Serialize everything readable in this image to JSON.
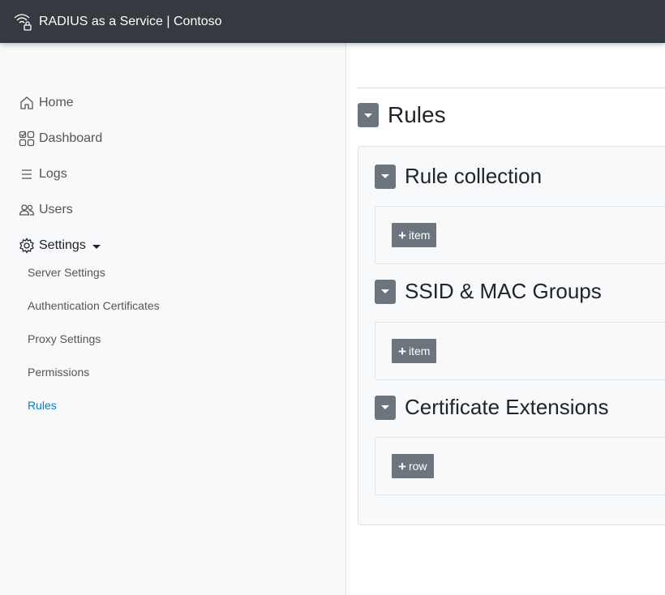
{
  "header": {
    "title": "RADIUS as a Service | Contoso",
    "logo_icon": "wifi-lock-icon"
  },
  "sidebar": {
    "items": [
      {
        "label": "Home",
        "icon": "home-icon"
      },
      {
        "label": "Dashboard",
        "icon": "dashboard-icon"
      },
      {
        "label": "Logs",
        "icon": "list-icon"
      },
      {
        "label": "Users",
        "icon": "users-icon"
      },
      {
        "label": "Settings",
        "icon": "gear-icon"
      }
    ],
    "settings_subitems": [
      {
        "label": "Server Settings"
      },
      {
        "label": "Authentication Certificates"
      },
      {
        "label": "Proxy Settings"
      },
      {
        "label": "Permissions"
      },
      {
        "label": "Rules",
        "active": true
      }
    ],
    "active_color": "#0d7cc1"
  },
  "main": {
    "heading": "Rules",
    "sections": [
      {
        "title": "Rule collection",
        "button": "item"
      },
      {
        "title": "SSID & MAC Groups",
        "button": "item"
      },
      {
        "title": "Certificate Extensions",
        "button": "row"
      }
    ]
  }
}
